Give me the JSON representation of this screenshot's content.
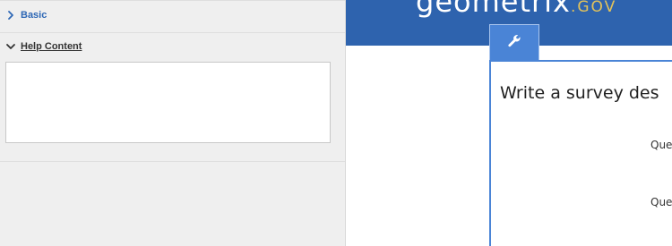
{
  "left_panel": {
    "sections": {
      "basic": {
        "label": "Basic",
        "expanded": false,
        "icon": "chevron-right-icon"
      },
      "help_content": {
        "label": "Help Content",
        "expanded": true,
        "icon": "chevron-down-icon",
        "value": ""
      }
    }
  },
  "header": {
    "brand_main": "geometrix",
    "brand_suffix": ".GOV",
    "background_color": "#2e63ae",
    "suffix_color": "#e2c25a"
  },
  "toolbar": {
    "settings_tab_icon": "wrench-icon"
  },
  "survey": {
    "title_partial": "Write a survey des",
    "questions": [
      {
        "label_partial": "Que"
      },
      {
        "label_partial": "Que"
      }
    ]
  },
  "colors": {
    "accent": "#4a84d6",
    "link": "#2d67b5",
    "panel_bg": "#efefef"
  }
}
